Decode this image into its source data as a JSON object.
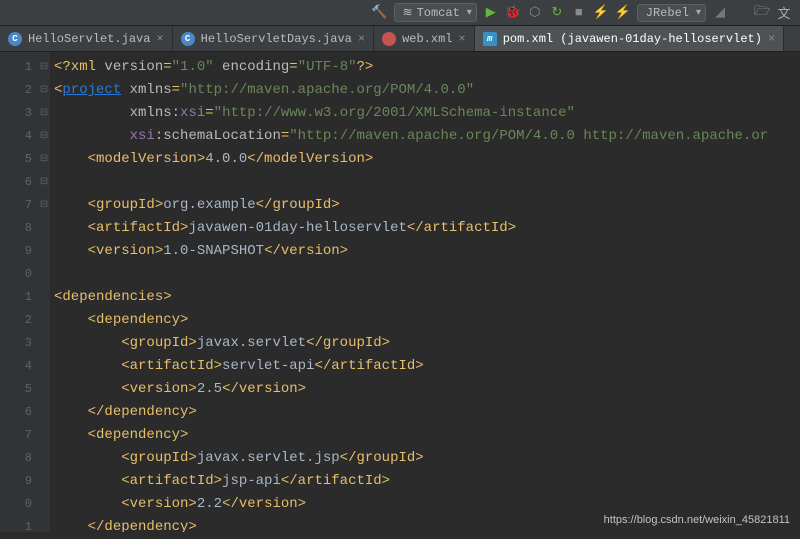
{
  "toolbar": {
    "run_config": "Tomcat",
    "jrebel": "JRebel"
  },
  "tabs": [
    {
      "icon": "C",
      "iconBg": "#4a88c7",
      "label": "HelloServlet.java",
      "active": false
    },
    {
      "icon": "C",
      "iconBg": "#4a88c7",
      "label": "HelloServletDays.java",
      "active": false
    },
    {
      "icon": "",
      "iconBg": "#c75450",
      "label": "web.xml",
      "active": false
    },
    {
      "icon": "m",
      "iconBg": "#3592c4",
      "label": "pom.xml (javawen-01day-helloservlet)",
      "active": true
    }
  ],
  "gutter": [
    "1",
    "2",
    "3",
    "4",
    "5",
    "6",
    "7",
    "8",
    "9",
    "0",
    "1",
    "2",
    "3",
    "4",
    "5",
    "6",
    "7",
    "8",
    "9",
    "0",
    "1"
  ],
  "folds": [
    "",
    "⊟",
    "",
    "",
    "⊟",
    "",
    "",
    "",
    "",
    "",
    "⊟",
    "⊟",
    "",
    "",
    "",
    "⊟",
    "⊟",
    "",
    "",
    "",
    "⊟"
  ],
  "code": {
    "l1_pi1": "<?xml ",
    "l1_a1": "version",
    "l1_v1": "\"1.0\"",
    "l1_a2": " encoding",
    "l1_v2": "\"UTF-8\"",
    "l1_pi2": "?>",
    "l2_t1": "<",
    "l2_tag": "project",
    "l2_a1": " xmlns",
    "l2_v1": "\"http://maven.apache.org/POM/4.0.0\"",
    "l3_pre": "         ",
    "l3_a1": "xmlns:",
    "l3_ns": "xsi",
    "l3_v1": "\"http://www.w3.org/2001/XMLSchema-instance\"",
    "l4_pre": "         ",
    "l4_ns": "xsi",
    "l4_a1": ":schemaLocation",
    "l4_v1": "\"http://maven.apache.org/POM/4.0.0 http://maven.apache.or",
    "l5_pre": "    ",
    "l5_t1": "<modelVersion>",
    "l5_txt": "4.0.0",
    "l5_t2": "</modelVersion>",
    "l7_pre": "    ",
    "l7_t1": "<groupId>",
    "l7_txt": "org.example",
    "l7_t2": "</groupId>",
    "l8_pre": "    ",
    "l8_t1": "<artifactId>",
    "l8_txt": "javawen-01day-helloservlet",
    "l8_t2": "</artifactId>",
    "l9_pre": "    ",
    "l9_t1": "<version>",
    "l9_txt": "1.0-SNAPSHOT",
    "l9_t2": "</version>",
    "l11_t1": "<dependencies>",
    "l12_pre": "    ",
    "l12_t1": "<dependency>",
    "l13_pre": "        ",
    "l13_t1": "<groupId>",
    "l13_txt": "javax.servlet",
    "l13_t2": "</groupId>",
    "l14_pre": "        ",
    "l14_t1": "<artifactId>",
    "l14_txt": "servlet-api",
    "l14_t2": "</artifactId>",
    "l15_pre": "        ",
    "l15_t1": "<version>",
    "l15_txt": "2.5",
    "l15_t2": "</version>",
    "l16_pre": "    ",
    "l16_t1": "</dependency>",
    "l17_pre": "    ",
    "l17_t1": "<dependency>",
    "l18_pre": "        ",
    "l18_t1": "<groupId>",
    "l18_txt": "javax.servlet.jsp",
    "l18_t2": "</groupId>",
    "l19_pre": "        ",
    "l19_t1": "<artifactId>",
    "l19_txt": "jsp-api",
    "l19_t2": "</artifactId>",
    "l20_pre": "        ",
    "l20_t1": "<version>",
    "l20_txt": "2.2",
    "l20_t2": "</version>",
    "l21_pre": "    ",
    "l21_t1": "</dependency>"
  },
  "watermark": "https://blog.csdn.net/weixin_45821811"
}
